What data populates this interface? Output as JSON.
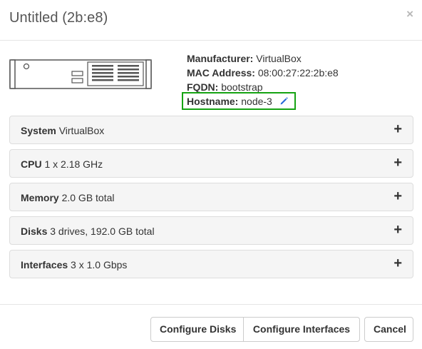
{
  "header": {
    "title": "Untitled (2b:e8)",
    "close_glyph": "×"
  },
  "node": {
    "image_icon": "server-icon",
    "manufacturer_label": "Manufacturer:",
    "manufacturer": "VirtualBox",
    "mac_label": "MAC Address:",
    "mac": "08:00:27:22:2b:e8",
    "fqdn_label": "FQDN:",
    "fqdn": "bootstrap",
    "hostname_label": "Hostname:",
    "hostname": "node-3",
    "edit_icon": "pencil-icon",
    "highlight_color": "#16a313"
  },
  "panels": [
    {
      "label": "System",
      "value": "VirtualBox",
      "expand_icon": "plus-icon"
    },
    {
      "label": "CPU",
      "value": "1 x 2.18 GHz",
      "expand_icon": "plus-icon"
    },
    {
      "label": "Memory",
      "value": "2.0 GB total",
      "expand_icon": "plus-icon"
    },
    {
      "label": "Disks",
      "value": "3 drives, 192.0 GB total",
      "expand_icon": "plus-icon"
    },
    {
      "label": "Interfaces",
      "value": "3 x 1.0 Gbps",
      "expand_icon": "plus-icon"
    }
  ],
  "footer": {
    "configure_disks": "Configure Disks",
    "configure_interfaces": "Configure Interfaces",
    "cancel": "Cancel"
  }
}
